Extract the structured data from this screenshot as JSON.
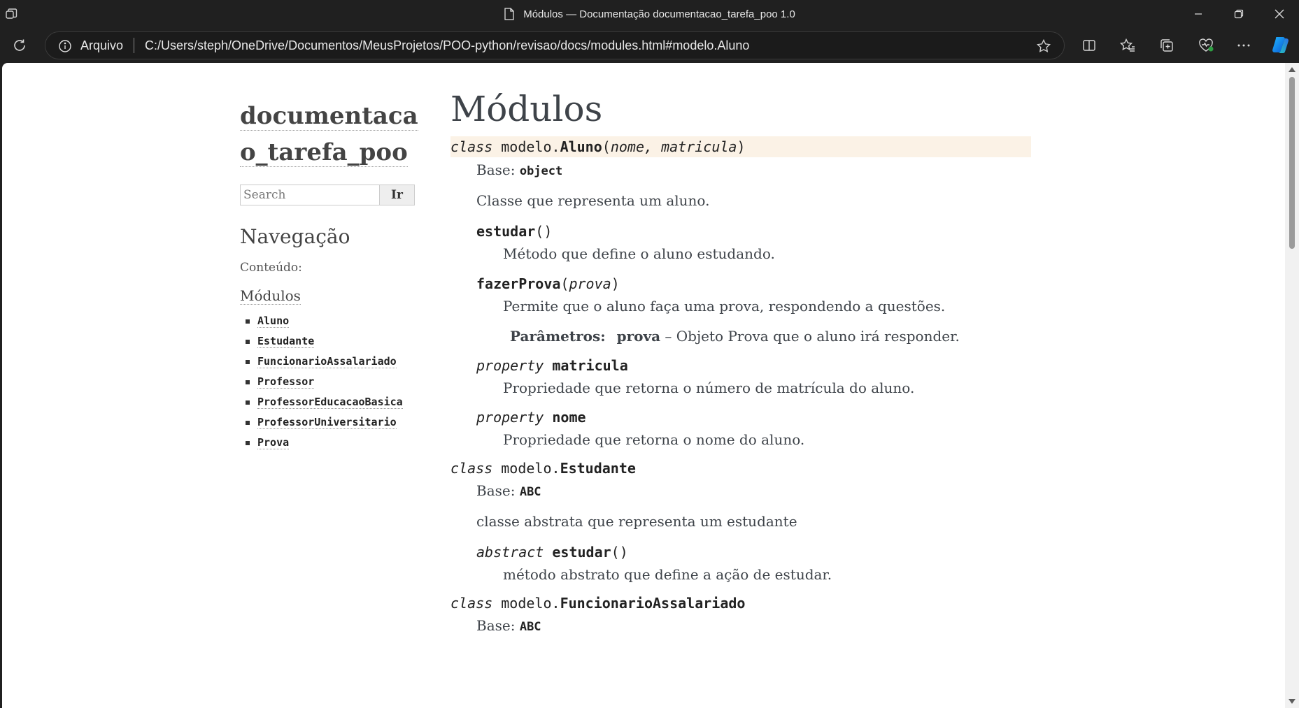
{
  "window": {
    "title": "Módulos — Documentação documentacao_tarefa_poo 1.0"
  },
  "addressbar": {
    "scheme_label": "Arquivo",
    "url": "C:/Users/steph/OneDrive/Documentos/MeusProjetos/POO-python/revisao/docs/modules.html#modelo.Aluno"
  },
  "sidebar": {
    "logo_line1": "documentaca",
    "logo_line2": "o_tarefa_poo",
    "search_placeholder": "Search",
    "search_button": "Ir",
    "nav_heading": "Navegação",
    "nav_caption": "Conteúdo:",
    "toc_top": "Módulos",
    "toc_items": [
      "Aluno",
      "Estudante",
      "FuncionarioAssalariado",
      "Professor",
      "ProfessorEducacaoBasica",
      "ProfessorUniversitario",
      "Prova"
    ]
  },
  "content": {
    "title": "Módulos",
    "aluno": {
      "kw": "class",
      "module": "modelo.",
      "name": "Aluno",
      "open": "(",
      "params": "nome, matricula",
      "close": ")",
      "base_label": "Base: ",
      "base": "object",
      "desc": "Classe que representa um aluno.",
      "estudar_name": "estudar",
      "estudar_parens": "()",
      "estudar_desc": "Método que define o aluno estudando.",
      "fazer_name": "fazerProva",
      "fazer_open": "(",
      "fazer_param": "prova",
      "fazer_close": ")",
      "fazer_desc": "Permite que o aluno faça uma prova, respondendo a questões.",
      "params_label": "Parâmetros:",
      "param_name": "prova",
      "param_desc": " – Objeto Prova que o aluno irá responder.",
      "prop_kw": "property",
      "matricula_name": "matricula",
      "matricula_desc": "Propriedade que retorna o número de matrícula do aluno.",
      "nome_name": "nome",
      "nome_desc": "Propriedade que retorna o nome do aluno."
    },
    "estudante": {
      "kw": "class",
      "module": "modelo.",
      "name": "Estudante",
      "base_label": "Base: ",
      "base": "ABC",
      "desc": "classe abstrata que representa um estudante",
      "abs_kw": "abstract",
      "estudar_name": "estudar",
      "estudar_parens": "()",
      "estudar_desc": "método abstrato que define a ação de estudar."
    },
    "funcionario": {
      "kw": "class",
      "module": "modelo.",
      "name": "FuncionarioAssalariado",
      "base_label": "Base: ",
      "base": "ABC"
    }
  }
}
